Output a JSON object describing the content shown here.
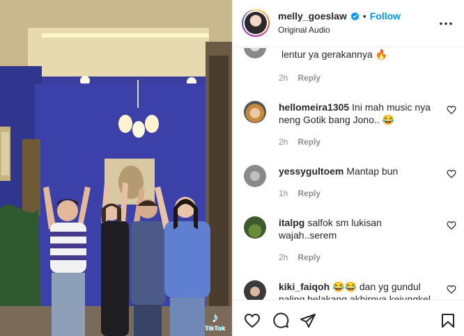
{
  "video": {
    "watermark_text": "TikTok",
    "watermark_icon": "tiktok-note-icon"
  },
  "header": {
    "username": "melly_goeslaw",
    "verified_icon": "verified-badge-icon",
    "separator": "•",
    "follow_label": "Follow",
    "audio_label": "Original Audio",
    "more_icon": "more-options-icon"
  },
  "comments": [
    {
      "user": "",
      "text": "lentur ya gerakannya 🔥",
      "time": "2h",
      "reply_label": "Reply"
    },
    {
      "user": "hellomeira1305",
      "text": "Ini mah music nya neng Gotik bang Jono.. 😂",
      "time": "2h",
      "reply_label": "Reply"
    },
    {
      "user": "yessygultoem",
      "text": "Mantap bun",
      "time": "1h",
      "reply_label": "Reply"
    },
    {
      "user": "italpg",
      "text": "salfok sm lukisan wajah..serem",
      "time": "2h",
      "reply_label": "Reply"
    },
    {
      "user": "kiki_faiqoh",
      "text": "😂😂 dan yg gundul paling belakang akhirnya kejungkel",
      "time": "",
      "reply_label": ""
    }
  ],
  "actions": {
    "like_icon": "heart-icon",
    "comment_icon": "comment-icon",
    "share_icon": "send-icon",
    "save_icon": "bookmark-icon"
  },
  "colors": {
    "link_blue": "#0095f6",
    "muted": "#8e8e8e",
    "border": "#efefef",
    "wall_blue": "#3a3f9e"
  }
}
